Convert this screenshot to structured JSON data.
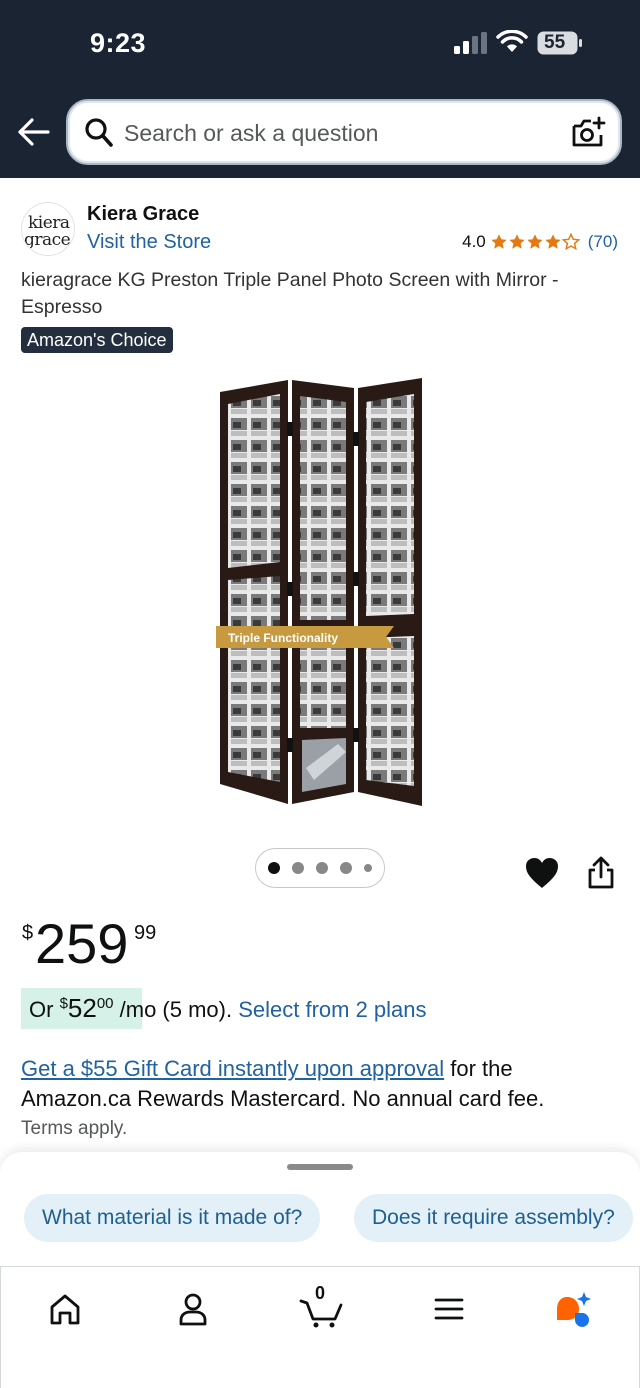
{
  "status_bar": {
    "time": "9:23",
    "battery": "55"
  },
  "search": {
    "placeholder": "Search or ask a question"
  },
  "brand": {
    "logo_line1": "kiera",
    "logo_line2": "grace",
    "name": "Kiera Grace",
    "visit_store": "Visit the Store"
  },
  "rating": {
    "value": "4.0",
    "stars": 4,
    "count": "(70)"
  },
  "product": {
    "title": "kieragrace KG Preston Triple Panel Photo Screen with Mirror - Espresso",
    "badge": "Amazon's Choice",
    "image_banner": "Triple Functionality"
  },
  "carousel": {
    "total_images": 5,
    "active_index": 0
  },
  "price": {
    "currency": "$",
    "whole": "259",
    "fraction": "99"
  },
  "installment": {
    "prefix": "Or ",
    "currency": "$",
    "whole": "52",
    "fraction": "00",
    "suffix": " /mo (5 mo). ",
    "link": "Select from 2 plans"
  },
  "card_offer": {
    "link": "Get a $55 Gift Card instantly upon approval",
    "text": " for the Amazon.ca Rewards Mastercard. No annual card fee.",
    "terms": "Terms apply."
  },
  "suggestions": [
    "What material is it made of?",
    "Does it require assembly?"
  ],
  "tabbar": {
    "cart_count": "0"
  },
  "colors": {
    "header_bg": "#1b2433",
    "link": "#2162a1",
    "badge_bg": "#232f3e",
    "installment_bg": "#d6f1e7",
    "chip_bg": "#e3f0f8",
    "star": "#e47911"
  },
  "icons": [
    "back-arrow-icon",
    "search-icon",
    "camera-icon",
    "heart-icon",
    "share-icon",
    "home-icon",
    "account-icon",
    "cart-icon",
    "menu-icon",
    "rufus-icon"
  ]
}
